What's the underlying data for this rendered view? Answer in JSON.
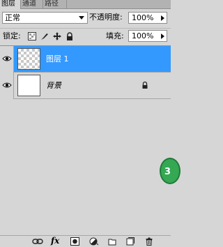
{
  "tabs": [
    "图层",
    "通道",
    "路径"
  ],
  "blend_mode": "正常",
  "opacity": {
    "label": "不透明度:",
    "value": "100%"
  },
  "lock": {
    "label": "锁定:"
  },
  "fill": {
    "label": "填充:",
    "value": "100%"
  },
  "layers": [
    {
      "name": "图层 1",
      "selected": true,
      "visible": true,
      "transparent": true
    },
    {
      "name": "背景",
      "selected": false,
      "visible": true,
      "locked": true,
      "italic": true
    }
  ],
  "badge": "3",
  "colors": {
    "selection": "#3399ff",
    "panel": "#d6d6d6",
    "badge": "#34a853"
  },
  "bottom_icons": [
    "link-icon",
    "fx-icon",
    "mask-icon",
    "adjustment-icon",
    "folder-icon",
    "new-layer-icon",
    "trash-icon"
  ],
  "fx_label": "fx"
}
